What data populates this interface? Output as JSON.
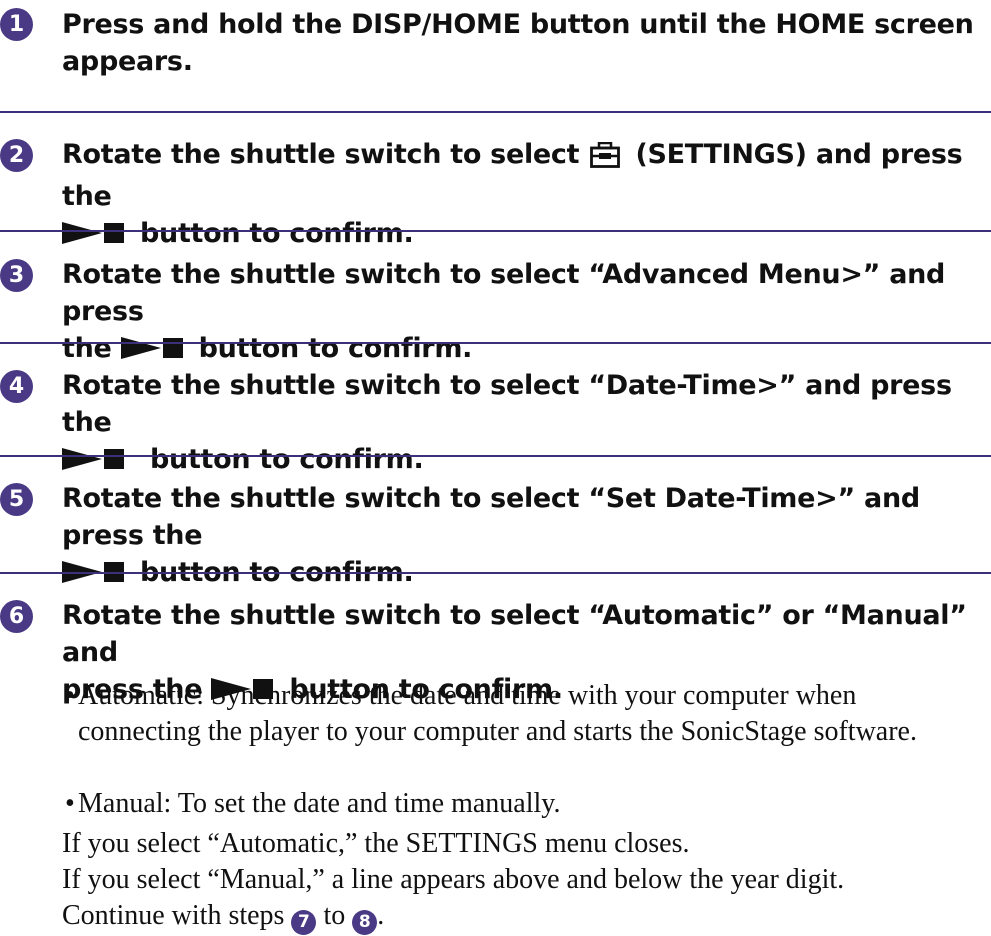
{
  "steps": [
    {
      "number": "1",
      "line1": "Press and hold the DISP/HOME button until the HOME screen",
      "line2": "appears."
    },
    {
      "number": "2",
      "line1_before": "Rotate the shuttle switch to select ",
      "line1_after": " (SETTINGS) and press the",
      "line2": "button to confirm."
    },
    {
      "number": "3",
      "line1": "Rotate the shuttle switch to select “Advanced Menu>” and press",
      "line2_before": "the ",
      "line2": "button to confirm."
    },
    {
      "number": "4",
      "line1": "Rotate the shuttle switch to select “Date-Time>” and press the",
      "line2": "button to confirm."
    },
    {
      "number": "5",
      "line1": "Rotate the shuttle switch to select “Set Date-Time>” and press the",
      "line2": "button to confirm."
    },
    {
      "number": "6",
      "line1": "Rotate the shuttle switch to select “Automatic” or “Manual” and",
      "line2_before": "press the ",
      "line2": "button to confirm."
    }
  ],
  "bullets": [
    {
      "dot": "•",
      "text": "Automatic: Synchronizes the date and time with your computer when connecting the player to your computer and starts the SonicStage software."
    },
    {
      "dot": "•",
      "text": "Manual: To set the date and time manually."
    }
  ],
  "notes": {
    "automatic": "If you select “Automatic,” the SETTINGS menu closes.",
    "manual": "If you select “Manual,” a line appears above and below the year digit.",
    "continue_before": "Continue with steps ",
    "continue_from": "7",
    "continue_mid": " to ",
    "continue_to": "8",
    "continue_after": "."
  },
  "icons": {
    "step_number": "numbered-circle",
    "settings": "settings-toolbox-icon",
    "play_stop": "play-stop-icon"
  },
  "colors": {
    "accent": "#4a3a86",
    "divider": "#3d2f7a",
    "text": "#111111"
  }
}
